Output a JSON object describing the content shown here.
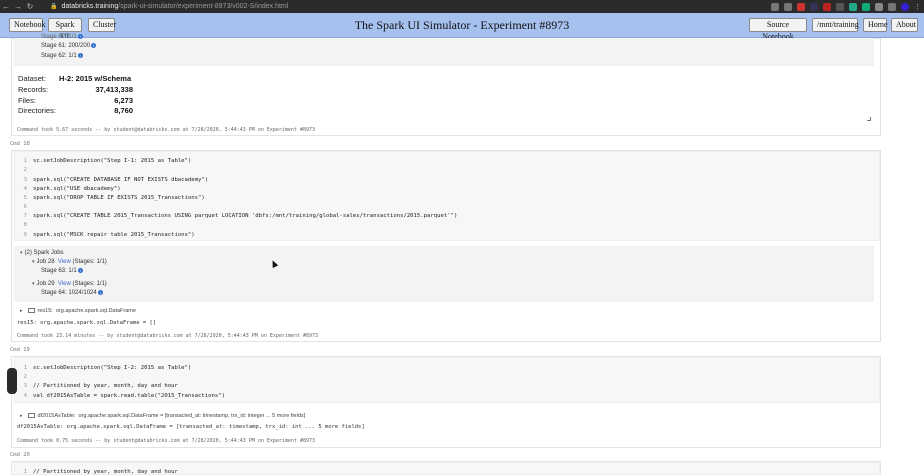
{
  "browser": {
    "url_host": "databricks.training",
    "url_path": "/spark-ui-simulator/experiment-8973/v002-S/index.html"
  },
  "header": {
    "buttons_left": [
      "Notebook",
      "Spark UI",
      "Cluster"
    ],
    "title": "The Spark UI Simulator - Experiment #8973",
    "buttons_right": [
      "Source Notebook",
      "/mnt/training",
      "Home",
      "About"
    ]
  },
  "top_cell": {
    "stage_partial": "Stage 6?: 1/1",
    "stage61": "Stage 61: 200/200",
    "stage62": "Stage 62: 1/1",
    "dataset_label": "Dataset:",
    "dataset_value": "H-2: 2015 w/Schema",
    "stats": [
      {
        "label": "Records:",
        "value": "37,413,338"
      },
      {
        "label": "Files:",
        "value": "6,273"
      },
      {
        "label": "Directories:",
        "value": "8,760"
      }
    ],
    "took": "Command took 5.67 seconds -- by student@databricks.com at 7/28/2020, 5:44:43 PM on Experiment #8973"
  },
  "cmd18": {
    "label": "Cmd 18",
    "code": [
      {
        "n": "1",
        "text": "sc.setJobDescription(\"Step I-1: 2015 as Table\")"
      },
      {
        "n": "2",
        "text": ""
      },
      {
        "n": "3",
        "text": "spark.sql(\"CREATE DATABASE IF NOT EXISTS dbacademy\")"
      },
      {
        "n": "4",
        "text": "spark.sql(\"USE dbacademy\")"
      },
      {
        "n": "5",
        "text": "spark.sql(\"DROP TABLE IF EXISTS 2015_Transactions\")"
      },
      {
        "n": "6",
        "text": ""
      },
      {
        "n": "7",
        "text": "spark.sql(\"CREATE TABLE 2015_Transactions USING parquet LOCATION 'dbfs:/mnt/training/global-sales/transactions/2015.parquet'\")"
      },
      {
        "n": "8",
        "text": ""
      },
      {
        "n": "9",
        "text": "spark.sql(\"MSCK repair table 2015_Transactions\")"
      }
    ],
    "jobs_header": "(2) Spark Jobs",
    "job28": "Job 28",
    "job28_view": "View",
    "job28_stages": "(Stages: 1/1)",
    "stage63": "Stage 63: 1/1",
    "job29": "Job 29",
    "job29_view": "View",
    "job29_stages": "(Stages: 1/1)",
    "stage64": "Stage 64: 1024/1024",
    "df_line": "res15:  org.apache.spark.sql.DataFrame",
    "df_out": "res15: org.apache.spark.sql.DataFrame = []",
    "took": "Command took 23.14 minutes -- by student@databricks.com at 7/28/2020, 5:44:43 PM on Experiment #8973"
  },
  "cmd19": {
    "label": "Cmd 19",
    "code": [
      {
        "n": "1",
        "text": "sc.setJobDescription(\"Step I-2: 2015 as Table\")"
      },
      {
        "n": "2",
        "text": ""
      },
      {
        "n": "3",
        "text": "// Partitioned by year, month, day and hour"
      },
      {
        "n": "4",
        "text": "val df2015AsTable = spark.read.table(\"2015_Transactions\")"
      }
    ],
    "df_line": "df2015AsTable:  org.apache.spark.sql.DataFrame = [transacted_at: timestamp, trx_id: integer ... 5 more fields]",
    "df_out": "df2015AsTable: org.apache.spark.sql.DataFrame = [transacted_at: timestamp, trx_id: int ... 5 more fields]",
    "took": "Command took 0.75 seconds -- by student@databricks.com at 7/28/2020, 5:44:43 PM on Experiment #8973"
  },
  "cmd20": {
    "label": "Cmd 20",
    "code": [
      {
        "n": "1",
        "text": "// Partitioned by year, month, day and hour"
      }
    ]
  },
  "info_glyph": "i",
  "expand_glyph": "▾",
  "collapse_glyph": "▸"
}
